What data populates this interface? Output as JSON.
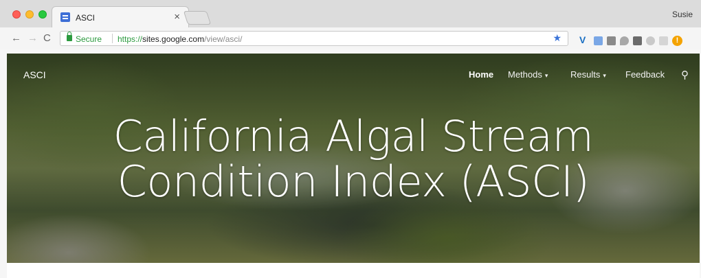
{
  "browser": {
    "tab": {
      "title": "ASCI",
      "close_glyph": "×",
      "favicon": "google-sites-icon"
    },
    "profile_name": "Susie",
    "nav": {
      "back": "←",
      "forward": "→",
      "reload": "C"
    },
    "address": {
      "secure_label": "Secure",
      "url_scheme": "https://",
      "url_host": "sites.google.com",
      "url_path": "/view/asci/"
    },
    "bookmark_glyph": "★",
    "extensions": {
      "v_label": "V",
      "warning_label": "!"
    }
  },
  "site": {
    "name": "ASCI",
    "nav": {
      "home": "Home",
      "methods": "Methods",
      "results": "Results",
      "feedback": "Feedback",
      "caret": "▾",
      "search_glyph": "⚲"
    },
    "hero": {
      "title_line1": "California Algal Stream",
      "title_line2": "Condition Index (ASCI)"
    }
  },
  "colors": {
    "secure_green": "#2b9a3e",
    "bookmark_blue": "#3a73d8",
    "hero_text": "#ffffff"
  }
}
